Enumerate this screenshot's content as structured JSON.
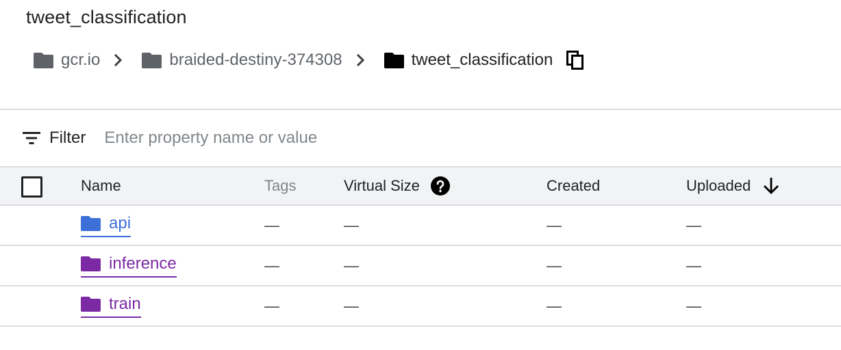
{
  "page": {
    "title": "tweet_classification"
  },
  "breadcrumb": {
    "items": [
      {
        "label": "gcr.io",
        "icon": "folder-icon"
      },
      {
        "label": "braided-destiny-374308",
        "icon": "folder-icon"
      },
      {
        "label": "tweet_classification",
        "icon": "folder-icon"
      }
    ],
    "copy_icon": "copy-icon"
  },
  "filter": {
    "label": "Filter",
    "placeholder": "Enter property name or value",
    "icon": "filter-icon"
  },
  "table": {
    "columns": {
      "name": "Name",
      "tags": "Tags",
      "virtual_size": "Virtual Size",
      "created": "Created",
      "uploaded": "Uploaded"
    },
    "help_icon": "help-icon",
    "sort_icon": "arrow-down-icon",
    "rows": [
      {
        "name": "api",
        "tags": "—",
        "virtual_size": "—",
        "created": "—",
        "uploaded": "—"
      },
      {
        "name": "inference",
        "tags": "—",
        "virtual_size": "—",
        "created": "—",
        "uploaded": "—"
      },
      {
        "name": "train",
        "tags": "—",
        "virtual_size": "—",
        "created": "—",
        "uploaded": "—"
      }
    ]
  },
  "colors": {
    "link_unvisited": "#3c6fd8",
    "link_visited": "#7b2aa4",
    "header_bg": "#f1f3f4",
    "divider": "#dadce0"
  }
}
